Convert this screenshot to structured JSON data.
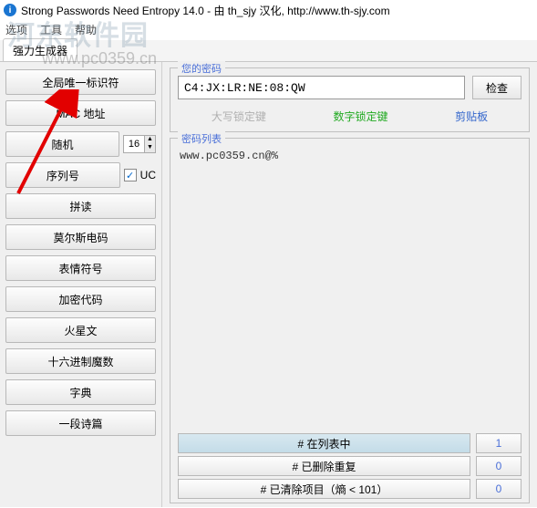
{
  "title": "Strong Passwords Need Entropy 14.0 - 由 th_sjy 汉化, http://www.th-sjy.com",
  "menu": {
    "options": "选项",
    "tools": "工具",
    "help": "帮助"
  },
  "tab": "强力生成器",
  "sidebar": {
    "items": [
      {
        "label": "全局唯一标识符"
      },
      {
        "label": "MAC 地址"
      },
      {
        "label": "随机",
        "spinner": "16"
      },
      {
        "label": "序列号",
        "check": "✓",
        "checklabel": "UC"
      },
      {
        "label": "拼读"
      },
      {
        "label": "莫尔斯电码"
      },
      {
        "label": "表情符号"
      },
      {
        "label": "加密代码"
      },
      {
        "label": "火星文"
      },
      {
        "label": "十六进制魔数"
      },
      {
        "label": "字典"
      },
      {
        "label": "一段诗篇"
      }
    ]
  },
  "password": {
    "legend": "您的密码",
    "value": "C4:JX:LR:NE:08:QW",
    "check_btn": "检查",
    "caps": "大写锁定键",
    "num": "数字锁定键",
    "clip": "剪贴板"
  },
  "list": {
    "legend": "密码列表",
    "content": "www.pc0359.cn@%"
  },
  "status": {
    "in_list": "# 在列表中",
    "in_list_count": "1",
    "dup": "# 已删除重复",
    "dup_count": "0",
    "cleared": "# 已清除项目（熵 < 101）",
    "cleared_count": "0"
  },
  "watermark1": "河东软件园",
  "watermark2": "www.pc0359.cn"
}
